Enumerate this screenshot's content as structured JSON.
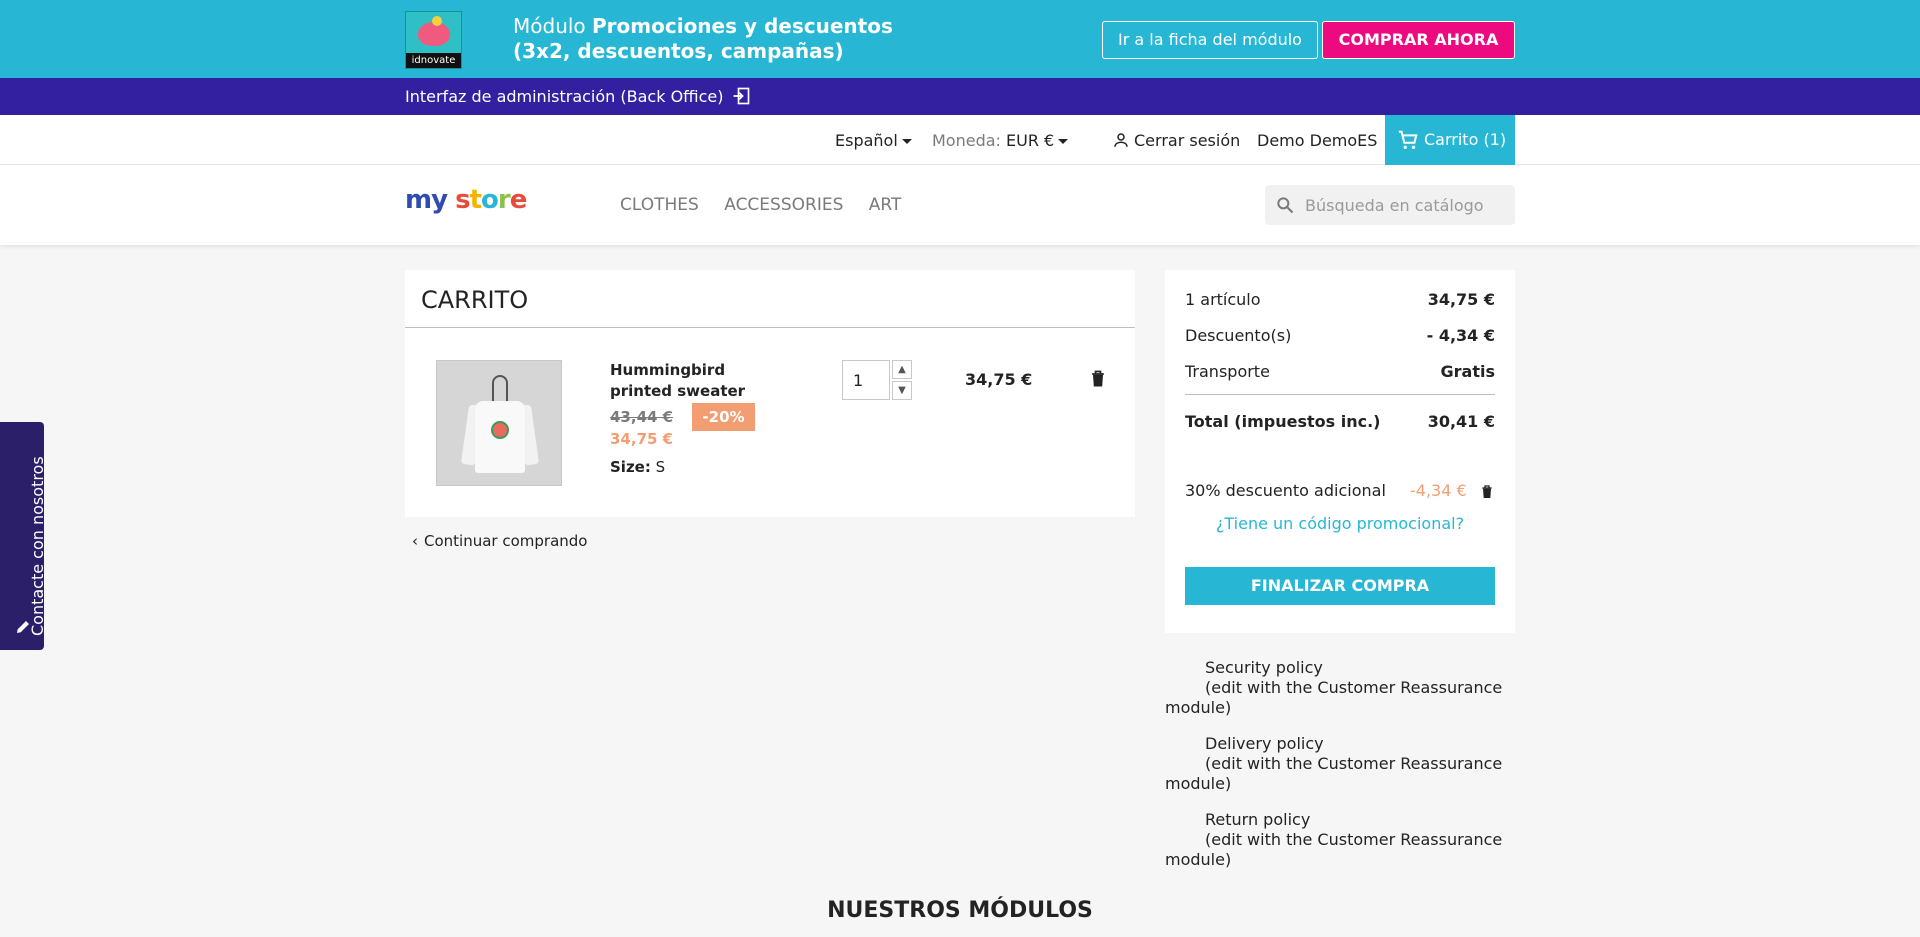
{
  "promo_banner": {
    "logo_brand": "idnovate",
    "title_prefix": "Módulo ",
    "title_bold": "Promociones y descuentos (3x2, descuentos, campañas)",
    "module_link": "Ir a la ficha del módulo",
    "buy_button": "COMPRAR AHORA"
  },
  "backoffice_bar": {
    "label": "Interfaz de administración (Back Office)"
  },
  "topnav": {
    "language": "Español",
    "currency_label": "Moneda:",
    "currency_value": "EUR €",
    "logout": "Cerrar sesión",
    "username": "Demo DemoES",
    "cart": "Carrito (1)"
  },
  "header": {
    "logo": {
      "m": "m",
      "y": "y",
      "space": " ",
      "s": "s",
      "t": "t",
      "o": "o",
      "r": "r",
      "e": "e"
    },
    "nav": [
      "CLOTHES",
      "ACCESSORIES",
      "ART"
    ],
    "search_placeholder": "Búsqueda en catálogo"
  },
  "cart": {
    "title": "CARRITO",
    "product": {
      "name": "Hummingbird printed sweater",
      "old_price": "43,44 €",
      "discount": "-20%",
      "price": "34,75 €",
      "size_label": "Size:",
      "size_value": "S",
      "quantity": "1",
      "line_total": "34,75 €"
    },
    "continue_shopping": "Continuar comprando"
  },
  "summary": {
    "items_label": "1 artículo",
    "items_value": "34,75 €",
    "discount_label": "Descuento(s)",
    "discount_value": "- 4,34 €",
    "shipping_label": "Transporte",
    "shipping_value": "Gratis",
    "total_label": "Total (impuestos inc.)",
    "total_value": "30,41 €",
    "voucher_name": "30% descuento adicional",
    "voucher_amount": "-4,34 €",
    "promo_code_link": "¿Tiene un código promocional?",
    "checkout_button": "FINALIZAR COMPRA"
  },
  "reassurance": [
    {
      "title": "Security policy",
      "line1": "(edit with the Customer Reassurance",
      "line2": "module)"
    },
    {
      "title": "Delivery policy",
      "line1": "(edit with the Customer Reassurance",
      "line2": "module)"
    },
    {
      "title": "Return policy",
      "line1": "(edit with the Customer Reassurance",
      "line2": "module)"
    }
  ],
  "footer": {
    "modules_title": "NUESTROS MÓDULOS"
  },
  "contact_tab": {
    "label": "Contacte con nosotros"
  },
  "colors": {
    "banner": "#27b7d5",
    "backoffice": "#3320a0",
    "buy_button": "#ec0a7e",
    "discount": "#f39d72",
    "accent": "#27b7d5",
    "contact_tab": "#2a1f68"
  },
  "icons": {
    "backoffice": "sign-in-icon",
    "user": "user-icon",
    "cart": "cart-icon",
    "search": "search-icon",
    "delete": "trash-icon",
    "back": "chevron-left-icon",
    "contact": "pencil-icon"
  }
}
